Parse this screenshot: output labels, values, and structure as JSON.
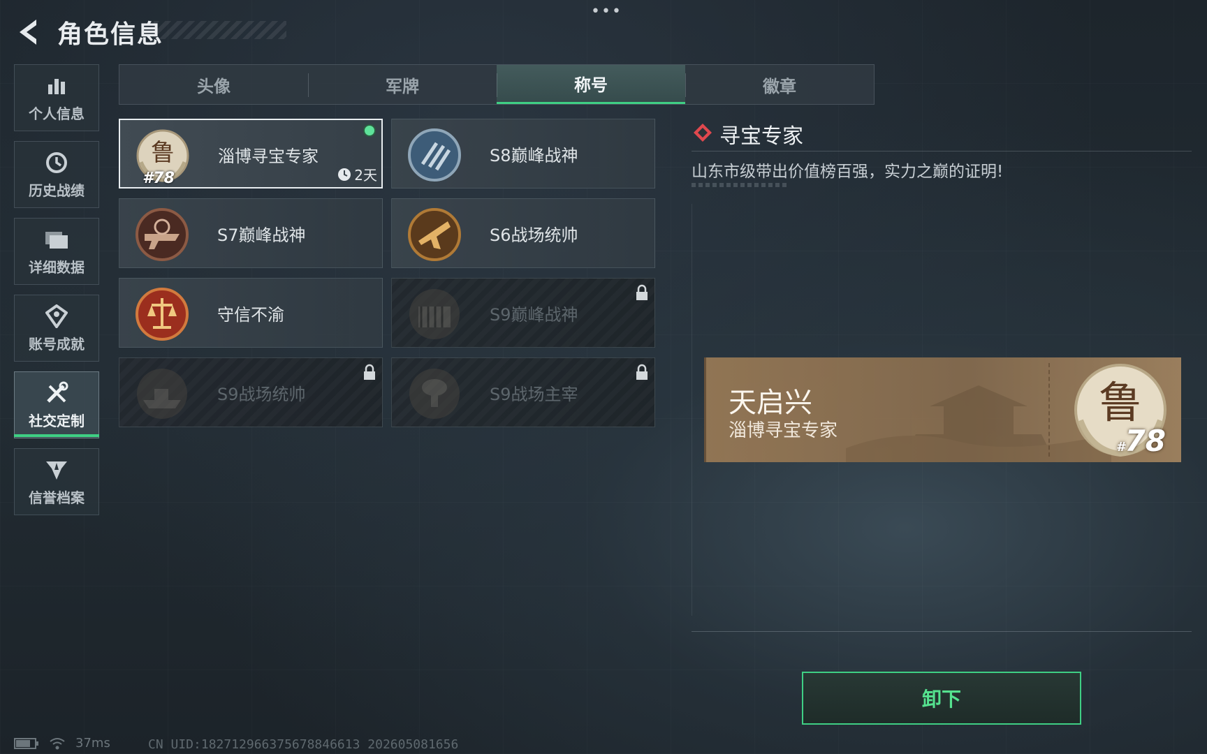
{
  "header": {
    "title": "角色信息",
    "more": "•••"
  },
  "nav": {
    "items": [
      {
        "label": "个人信息",
        "icon": "bar-chart-icon"
      },
      {
        "label": "历史战绩",
        "icon": "history-icon"
      },
      {
        "label": "详细数据",
        "icon": "folder-icon"
      },
      {
        "label": "账号成就",
        "icon": "achievement-icon"
      },
      {
        "label": "社交定制",
        "icon": "tools-icon"
      },
      {
        "label": "信誉档案",
        "icon": "credit-icon"
      }
    ],
    "active_index": 4
  },
  "tabs": {
    "items": [
      "头像",
      "军牌",
      "称号",
      "徽章"
    ],
    "active_index": 2
  },
  "cards": [
    {
      "name": "淄博寻宝专家",
      "rank": "#78",
      "timer": "2天",
      "equipped": true,
      "locked": false,
      "badge": "lu-seal-badge"
    },
    {
      "name": "S8巅峰战神",
      "locked": false,
      "badge": "s8-badge"
    },
    {
      "name": "S7巅峰战神",
      "locked": false,
      "badge": "s7-badge"
    },
    {
      "name": "S6战场统帅",
      "locked": false,
      "badge": "s6-badge"
    },
    {
      "name": "守信不渝",
      "locked": false,
      "badge": "scales-badge"
    },
    {
      "name": "S9巅峰战神",
      "locked": true,
      "badge": "s9-dam-badge"
    },
    {
      "name": "S9战场统帅",
      "locked": true,
      "badge": "s9-ship-badge"
    },
    {
      "name": "S9战场主宰",
      "locked": true,
      "badge": "s9-mushroom-badge"
    }
  ],
  "detail": {
    "title": "寻宝专家",
    "description": "山东市级带出价值榜百强，实力之巅的证明!",
    "preview": {
      "player_name": "天启兴",
      "title_text": "淄博寻宝专家",
      "rank": "78",
      "rank_prefix": "#"
    }
  },
  "actions": {
    "unequip_label": "卸下"
  },
  "status": {
    "ping": "37ms",
    "uid": "CN UID:182712966375678846613 202605081656"
  },
  "colors": {
    "accent": "#3fcf84",
    "diamond": "#e0484e",
    "plate": "#9a7a55"
  }
}
